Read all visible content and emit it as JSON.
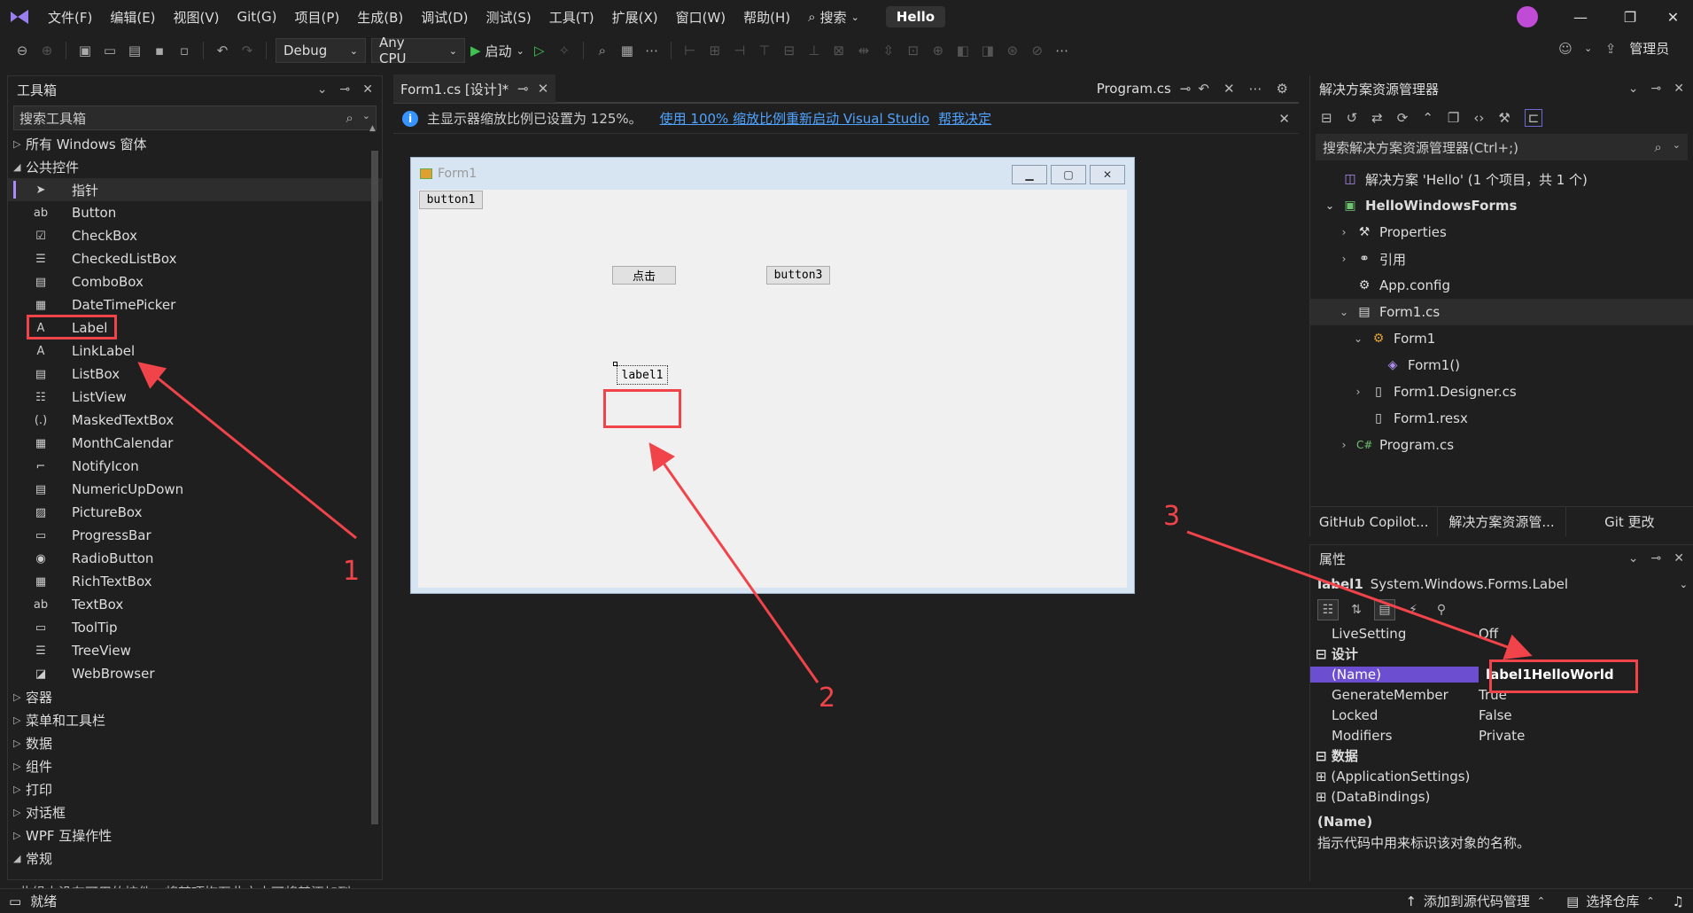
{
  "menubar": {
    "items": [
      "文件(F)",
      "编辑(E)",
      "视图(V)",
      "Git(G)",
      "项目(P)",
      "生成(B)",
      "调试(D)",
      "测试(S)",
      "工具(T)",
      "扩展(X)",
      "窗口(W)",
      "帮助(H)"
    ],
    "search": "搜索",
    "solution_badge": "Hello"
  },
  "toolbar": {
    "config": "Debug",
    "platform": "Any CPU",
    "start": "启动",
    "admin": "管理员"
  },
  "toolbox": {
    "title": "工具箱",
    "search_placeholder": "搜索工具箱",
    "categories_top": [
      "所有 Windows 窗体",
      "公共控件"
    ],
    "tools": [
      "指针",
      "Button",
      "CheckBox",
      "CheckedListBox",
      "ComboBox",
      "DateTimePicker",
      "Label",
      "LinkLabel",
      "ListBox",
      "ListView",
      "MaskedTextBox",
      "MonthCalendar",
      "NotifyIcon",
      "NumericUpDown",
      "PictureBox",
      "ProgressBar",
      "RadioButton",
      "RichTextBox",
      "TextBox",
      "ToolTip",
      "TreeView",
      "WebBrowser"
    ],
    "categories_bottom": [
      "容器",
      "菜单和工具栏",
      "数据",
      "组件",
      "打印",
      "对话框",
      "WPF 互操作性",
      "常规"
    ],
    "footer_text": "此组中没有可用的控件。将某项拖至此文本可将其添加到"
  },
  "editor": {
    "tab_active": "Form1.cs [设计]*",
    "tab_right": "Program.cs",
    "info_text": "主显示器缩放比例已设置为 125%。",
    "info_link1": "使用 100% 缩放比例重新启动 Visual Studio",
    "info_link2": "帮我决定"
  },
  "form": {
    "title": "Form1",
    "button1": "button1",
    "button_click": "点击",
    "button3": "button3",
    "label1": "label1"
  },
  "solution_explorer": {
    "title": "解决方案资源管理器",
    "search_placeholder": "搜索解决方案资源管理器(Ctrl+;)",
    "nodes": [
      "解决方案 'Hello' (1 个项目，共 1 个)",
      "HelloWindowsForms",
      "Properties",
      "引用",
      "App.config",
      "Form1.cs",
      "Form1",
      "Form1()",
      "Form1.Designer.cs",
      "Form1.resx",
      "Program.cs"
    ],
    "bottom_tabs": [
      "GitHub Copilot...",
      "解决方案资源管...",
      "Git 更改"
    ]
  },
  "properties": {
    "title": "属性",
    "object_name": "label1",
    "object_type": "System.Windows.Forms.Label",
    "rows": [
      {
        "name": "LiveSetting",
        "value": "Off"
      },
      {
        "name": "设计",
        "value": ""
      },
      {
        "name": "(Name)",
        "value": "label1HelloWorld"
      },
      {
        "name": "GenerateMember",
        "value": "True"
      },
      {
        "name": "Locked",
        "value": "False"
      },
      {
        "name": "Modifiers",
        "value": "Private"
      },
      {
        "name": "数据",
        "value": ""
      },
      {
        "name": "(ApplicationSettings)",
        "value": ""
      },
      {
        "name": "(DataBindings)",
        "value": ""
      }
    ],
    "desc_title": "(Name)",
    "desc_text": "指示代码中用来标识该对象的名称。"
  },
  "statusbar": {
    "ready": "就绪",
    "add_source": "添加到源代码管理",
    "select_repo": "选择仓库"
  },
  "annotations": [
    "1",
    "2",
    "3"
  ],
  "colors": {
    "accent": "#a98af7",
    "annotation": "#f0444a",
    "link": "#4fa3ff"
  }
}
